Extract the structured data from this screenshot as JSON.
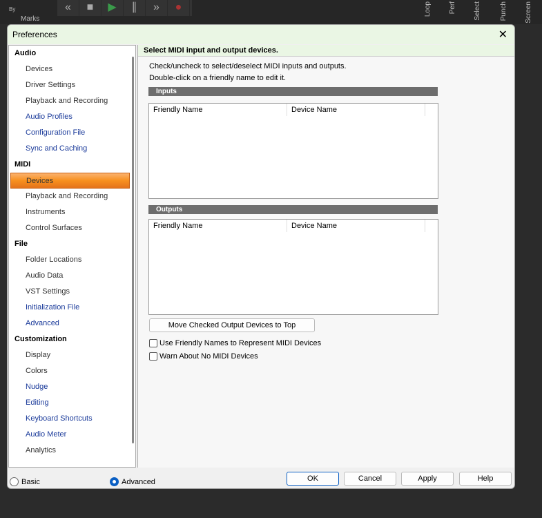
{
  "background": {
    "marks": "Marks",
    "by": "By",
    "vertical_labels": [
      "Loop",
      "Perf",
      "Select",
      "Punch",
      "Screen"
    ]
  },
  "dialog": {
    "title": "Preferences"
  },
  "sidebar": [
    {
      "category": "Audio",
      "items": [
        {
          "label": "Devices"
        },
        {
          "label": "Driver Settings"
        },
        {
          "label": "Playback and Recording"
        },
        {
          "label": "Audio Profiles",
          "blue": true
        },
        {
          "label": "Configuration File",
          "blue": true
        },
        {
          "label": "Sync and Caching",
          "blue": true
        }
      ]
    },
    {
      "category": "MIDI",
      "items": [
        {
          "label": "Devices",
          "selected": true
        },
        {
          "label": "Playback and Recording"
        },
        {
          "label": "Instruments"
        },
        {
          "label": "Control Surfaces"
        }
      ]
    },
    {
      "category": "File",
      "items": [
        {
          "label": "Folder Locations"
        },
        {
          "label": "Audio Data"
        },
        {
          "label": "VST Settings"
        },
        {
          "label": "Initialization File",
          "blue": true
        },
        {
          "label": "Advanced",
          "blue": true
        }
      ]
    },
    {
      "category": "Customization",
      "items": [
        {
          "label": "Display"
        },
        {
          "label": "Colors"
        },
        {
          "label": "Nudge",
          "blue": true
        },
        {
          "label": "Editing",
          "blue": true
        },
        {
          "label": "Keyboard Shortcuts",
          "blue": true
        },
        {
          "label": "Audio Meter",
          "blue": true
        },
        {
          "label": "Analytics"
        }
      ]
    }
  ],
  "main": {
    "header": "Select MIDI input and output devices.",
    "line1": "Check/uncheck to select/deselect MIDI inputs and outputs.",
    "line2": "Double-click on a friendly name to edit it.",
    "inputs_label": "Inputs",
    "outputs_label": "Outputs",
    "col_friendly": "Friendly Name",
    "col_device": "Device Name",
    "move_button": "Move Checked Output Devices to Top",
    "chk_friendly": "Use Friendly Names to Represent MIDI Devices",
    "chk_warn": "Warn About No MIDI Devices"
  },
  "footer": {
    "basic": "Basic",
    "advanced": "Advanced",
    "mode_selected": "Advanced",
    "ok": "OK",
    "cancel": "Cancel",
    "apply": "Apply",
    "help": "Help"
  },
  "colors": {
    "selection": "#f7901e",
    "header_bg": "#eaf6e4",
    "radio_accent": "#0a5fc4"
  }
}
